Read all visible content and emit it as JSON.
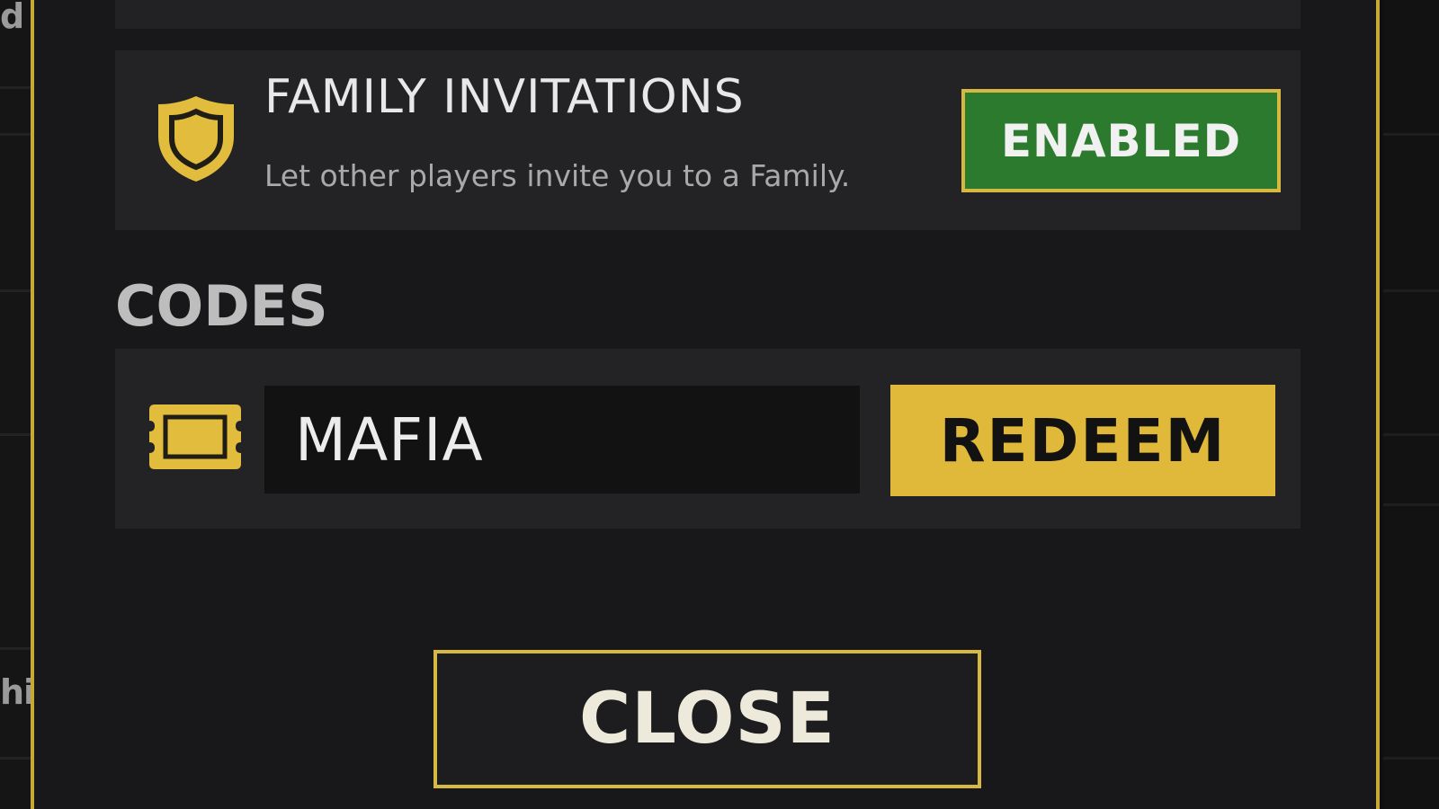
{
  "background": {
    "left_peek_top": "d",
    "left_peek_bottom": "hi"
  },
  "family_invitations": {
    "title": "FAMILY INVITATIONS",
    "description": "Let other players invite you to a Family.",
    "toggle_label": "ENABLED",
    "icon": "shield-icon"
  },
  "codes": {
    "heading": "CODES",
    "input_value": "MAFIA",
    "redeem_label": "REDEEM",
    "icon": "ticket-icon"
  },
  "close_label": "CLOSE",
  "colors": {
    "accent_gold": "#d7b840",
    "enabled_green": "#2b7a2e",
    "panel_bg": "#18181a",
    "card_bg": "#232326"
  }
}
